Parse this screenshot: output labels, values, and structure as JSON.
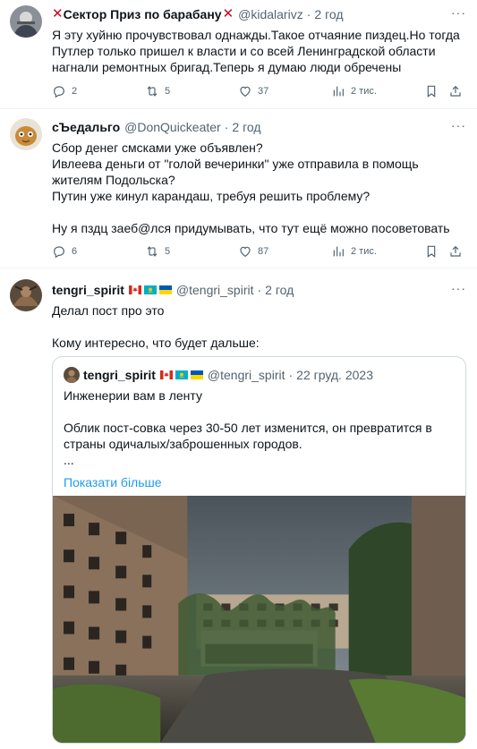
{
  "tweets": [
    {
      "name": "Сектор Приз по барабану",
      "handle": "@kidalarivz",
      "time": "2 год",
      "text": "Я эту хуйню прочувствовал однажды.Такое отчаяние пиздец.Но тогда Путлер только пришел к власти и со всей Ленинградской области нагнали ремонтных бригад.Теперь я думаю люди обречены",
      "replies": "2",
      "retweets": "5",
      "likes": "37",
      "views": "2 тис."
    },
    {
      "name": "сЪедальго",
      "handle": "@DonQuickeater",
      "time": "2 год",
      "text": "Сбор денег смсками уже объявлен?\nИвлеева деньги от \"голой вечеринки\" уже отправила в помощь жителям Подольска?\nПутин уже кинул карандаш, требуя решить проблему?\n\nНу я пздц заеб@лся придумывать, что тут ещё можно посоветовать",
      "replies": "6",
      "retweets": "5",
      "likes": "87",
      "views": "2 тис."
    },
    {
      "name": "tengri_spirit",
      "handle": "@tengri_spirit",
      "time": "2 год",
      "text": "Делал пост про это\n\nКому интересно, что будет дальше:",
      "quote": {
        "name": "tengri_spirit",
        "handle": "@tengri_spirit",
        "time": "22 груд. 2023",
        "text": "Инженерии вам в ленту\n\nОблик пост-совка через 30-50 лет изменится, он превратится в страны одичалых/заброшенных городов.\n...",
        "show_more": "Показати більше"
      }
    }
  ],
  "more": "···",
  "dot": "·",
  "colors": {
    "accent": "#1d9bf0",
    "muted": "#536471",
    "border": "#eff3f4"
  },
  "icons": [
    "close-x-red-icon",
    "reply-icon",
    "retweet-icon",
    "like-icon",
    "views-icon",
    "bookmark-icon",
    "share-icon",
    "canada-flag-icon",
    "kazakhstan-flag-icon",
    "ukraine-flag-icon"
  ]
}
